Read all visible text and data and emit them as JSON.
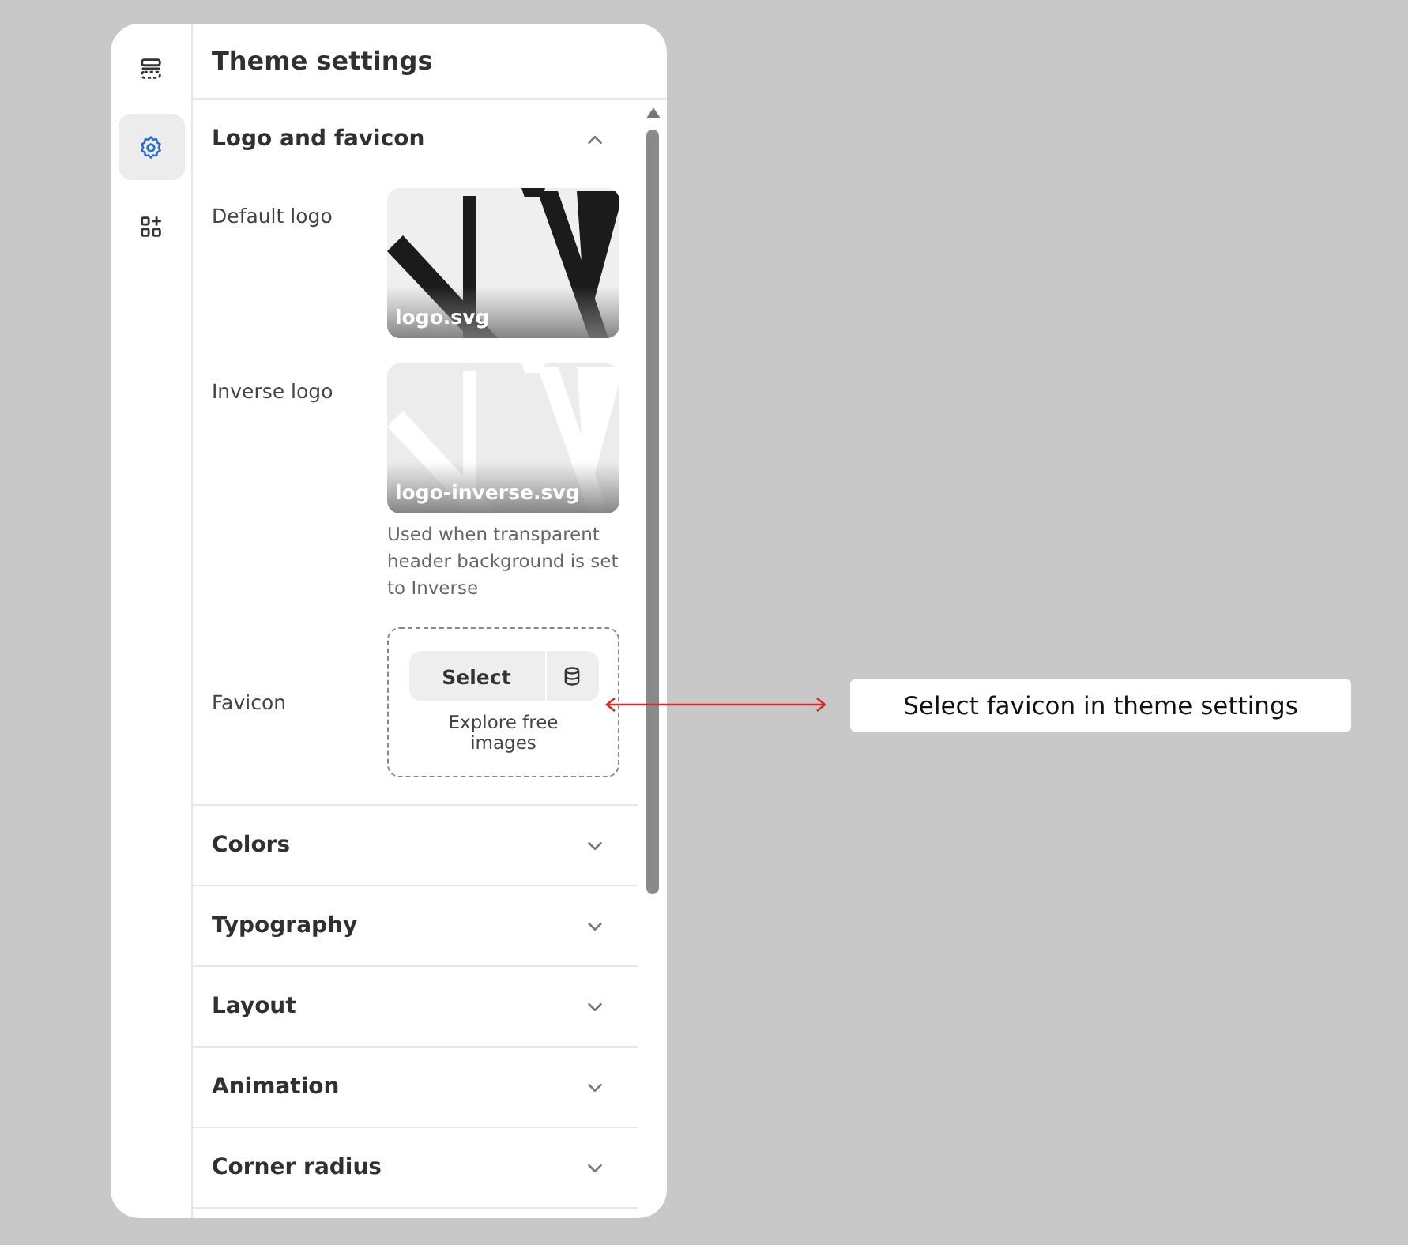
{
  "rail": {
    "items": [
      {
        "kind": "sections",
        "selected": false
      },
      {
        "kind": "settings",
        "selected": true
      },
      {
        "kind": "apps",
        "selected": false
      }
    ]
  },
  "panel": {
    "title": "Theme settings"
  },
  "sections": [
    {
      "title": "Logo and favicon",
      "expanded": true,
      "fields": [
        {
          "label": "Default logo",
          "file": "logo.svg",
          "inverse": false
        },
        {
          "label": "Inverse logo",
          "file": "logo-inverse.svg",
          "inverse": true,
          "hint": "Used when transparent header background is set to Inverse"
        },
        {
          "kind": "upload",
          "label": "Favicon",
          "button": "Select",
          "link": "Explore free images"
        }
      ]
    },
    {
      "title": "Colors",
      "expanded": false
    },
    {
      "title": "Typography",
      "expanded": false
    },
    {
      "title": "Layout",
      "expanded": false
    },
    {
      "title": "Animation",
      "expanded": false
    },
    {
      "title": "Corner radius",
      "expanded": false
    }
  ],
  "callout": {
    "text": "Select favicon in theme settings"
  }
}
